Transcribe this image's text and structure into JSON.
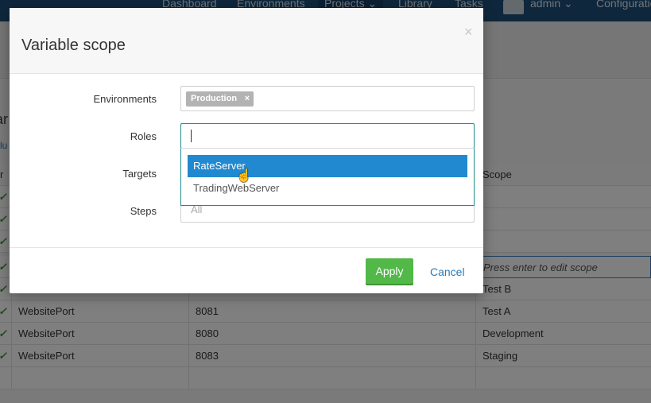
{
  "topnav": {
    "items": [
      "Dashboard",
      "Environments",
      "Projects",
      "Library",
      "Tasks"
    ],
    "user": "admin",
    "configuration": "Configuratio"
  },
  "background": {
    "title_fragment": "ar",
    "link_fragment": "clu",
    "grid": {
      "header_first": "r",
      "header_scope": "Scope",
      "edit_hint": "Press enter to edit scope",
      "rows": [
        {
          "name": "WebsitePort",
          "value": "8081",
          "scope": "Test A"
        },
        {
          "name": "WebsitePort",
          "value": "8080",
          "scope": "Development"
        },
        {
          "name": "WebsitePort",
          "value": "8083",
          "scope": "Staging"
        }
      ],
      "row_above": {
        "scope": "Test B"
      }
    }
  },
  "modal": {
    "title": "Variable scope",
    "close_icon": "×",
    "fields": {
      "environments": {
        "label": "Environments",
        "chip": "Production",
        "chip_remove": "×"
      },
      "roles": {
        "label": "Roles",
        "value": ""
      },
      "targets": {
        "label": "Targets"
      },
      "steps": {
        "label": "Steps",
        "placeholder": "All"
      }
    },
    "dropdown": {
      "options": [
        "RateServer",
        "TradingWebServer"
      ],
      "active_index": 0
    },
    "footer": {
      "apply": "Apply",
      "cancel": "Cancel"
    }
  }
}
